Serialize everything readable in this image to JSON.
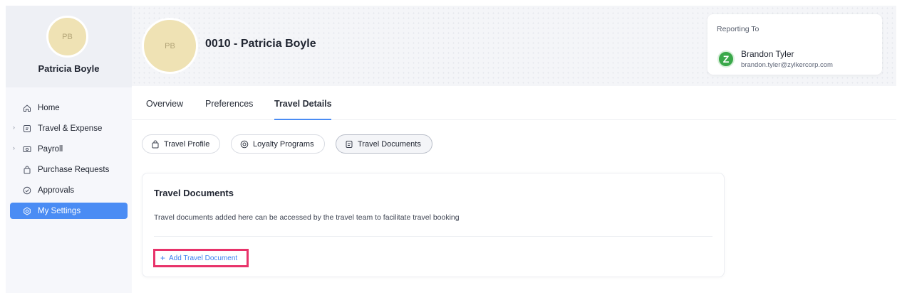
{
  "sidebar": {
    "avatar_initials": "PB",
    "user_name": "Patricia Boyle",
    "items": [
      {
        "label": "Home",
        "icon": "home-icon",
        "expandable": false
      },
      {
        "label": "Travel & Expense",
        "icon": "document-icon",
        "expandable": true
      },
      {
        "label": "Payroll",
        "icon": "money-icon",
        "expandable": true
      },
      {
        "label": "Purchase Requests",
        "icon": "bag-icon",
        "expandable": false
      },
      {
        "label": "Approvals",
        "icon": "check-circle-icon",
        "expandable": false
      },
      {
        "label": "My Settings",
        "icon": "settings-icon",
        "expandable": false,
        "active": true
      }
    ]
  },
  "header": {
    "avatar_initials": "PB",
    "employee_title": "0010 - Patricia Boyle",
    "reporting": {
      "label": "Reporting To",
      "logo_letter": "Z",
      "name": "Brandon Tyler",
      "email": "brandon.tyler@zylkercorp.com"
    }
  },
  "tabs": [
    {
      "label": "Overview"
    },
    {
      "label": "Preferences"
    },
    {
      "label": "Travel Details",
      "active": true
    }
  ],
  "sub_tabs": [
    {
      "label": "Travel Profile",
      "icon": "bag-icon"
    },
    {
      "label": "Loyalty Programs",
      "icon": "target-icon"
    },
    {
      "label": "Travel Documents",
      "icon": "document-icon",
      "selected": true
    }
  ],
  "card": {
    "title": "Travel Documents",
    "description": "Travel documents added here can be accessed by the travel team to facilitate travel booking",
    "add_button_label": "Add Travel Document"
  },
  "colors": {
    "accent": "#4a8cf4",
    "highlight": "#e8336a",
    "avatar_bg": "#efe2b4",
    "logo_green": "#3aa84a"
  }
}
